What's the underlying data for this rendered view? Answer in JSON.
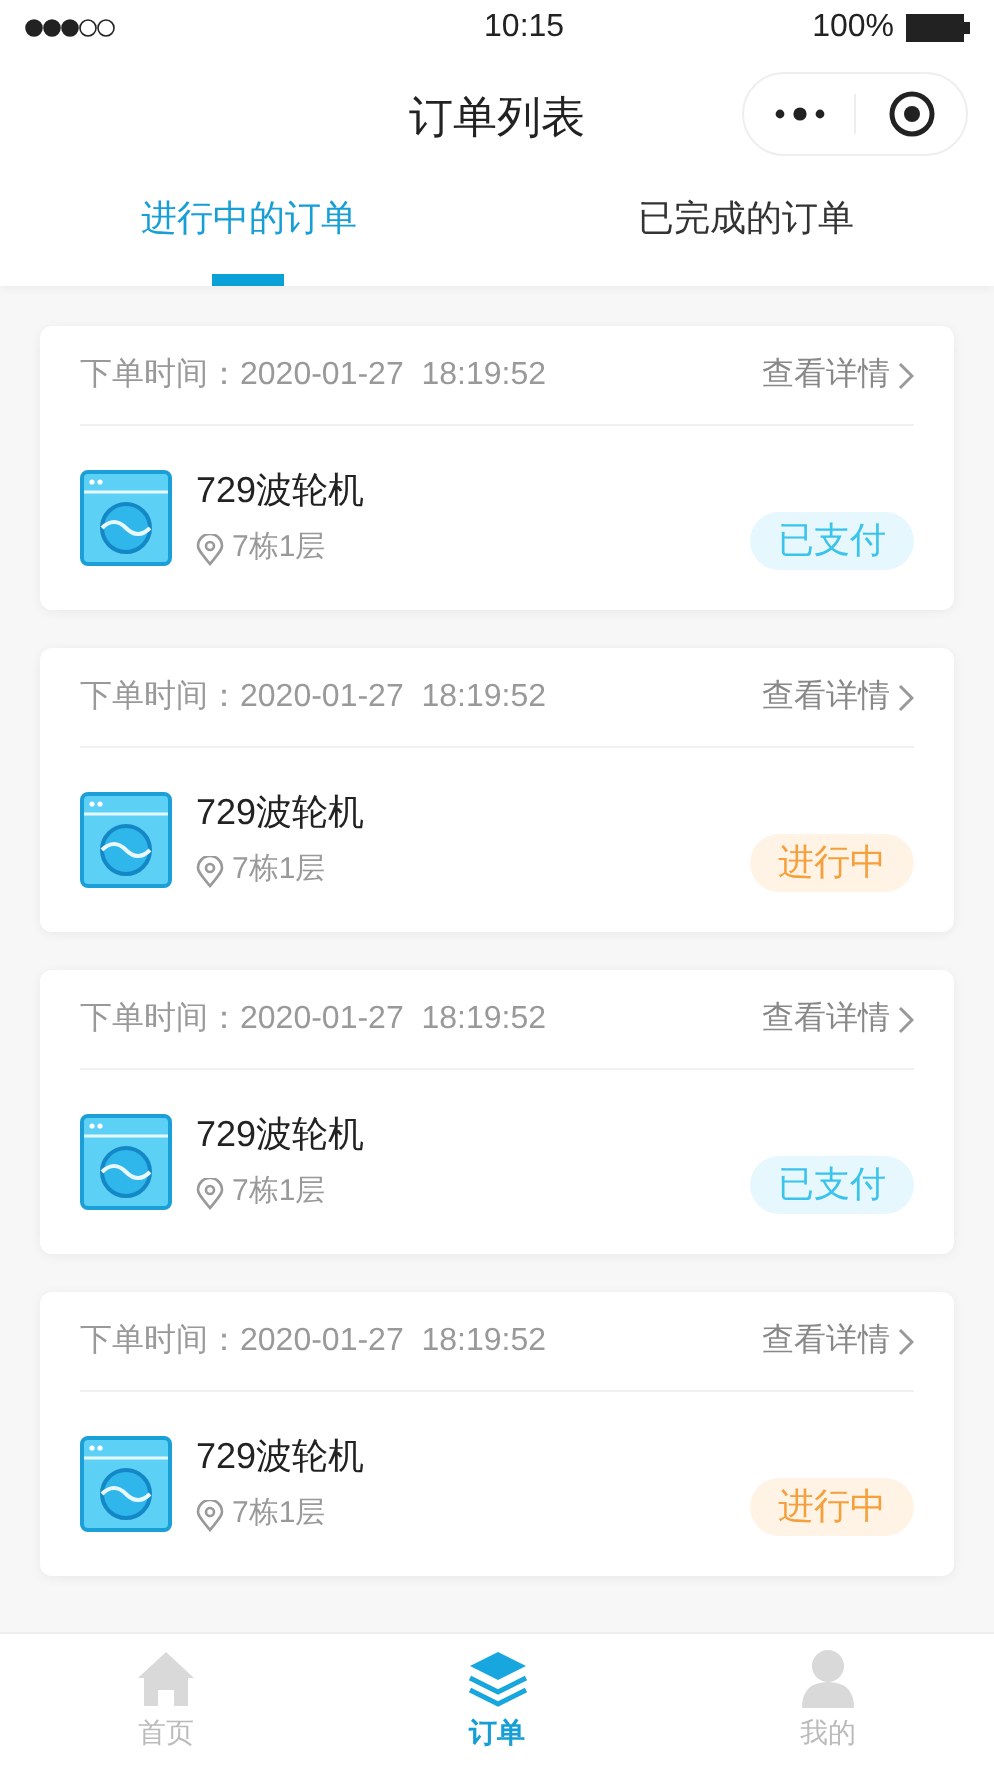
{
  "status_bar": {
    "time": "10:15",
    "battery": "100%"
  },
  "header": {
    "title": "订单列表"
  },
  "tabs": [
    {
      "label": "进行中的订单",
      "selected": true
    },
    {
      "label": "已完成的订单",
      "selected": false
    }
  ],
  "orders": [
    {
      "time_label": "下单时间：",
      "time": "2020-01-27  18:19:52",
      "details": "查看详情",
      "name": "729波轮机",
      "location": "7栋1层",
      "status": "已支付",
      "kind": "paid"
    },
    {
      "time_label": "下单时间：",
      "time": "2020-01-27  18:19:52",
      "details": "查看详情",
      "name": "729波轮机",
      "location": "7栋1层",
      "status": "进行中",
      "kind": "progress"
    },
    {
      "time_label": "下单时间：",
      "time": "2020-01-27  18:19:52",
      "details": "查看详情",
      "name": "729波轮机",
      "location": "7栋1层",
      "status": "已支付",
      "kind": "paid"
    },
    {
      "time_label": "下单时间：",
      "time": "2020-01-27  18:19:52",
      "details": "查看详情",
      "name": "729波轮机",
      "location": "7栋1层",
      "status": "进行中",
      "kind": "progress"
    }
  ],
  "tab_bar": [
    {
      "label": "首页",
      "kind": "home",
      "selected": false
    },
    {
      "label": "订单",
      "kind": "orders",
      "selected": true
    },
    {
      "label": "我的",
      "kind": "profile",
      "selected": false
    }
  ]
}
